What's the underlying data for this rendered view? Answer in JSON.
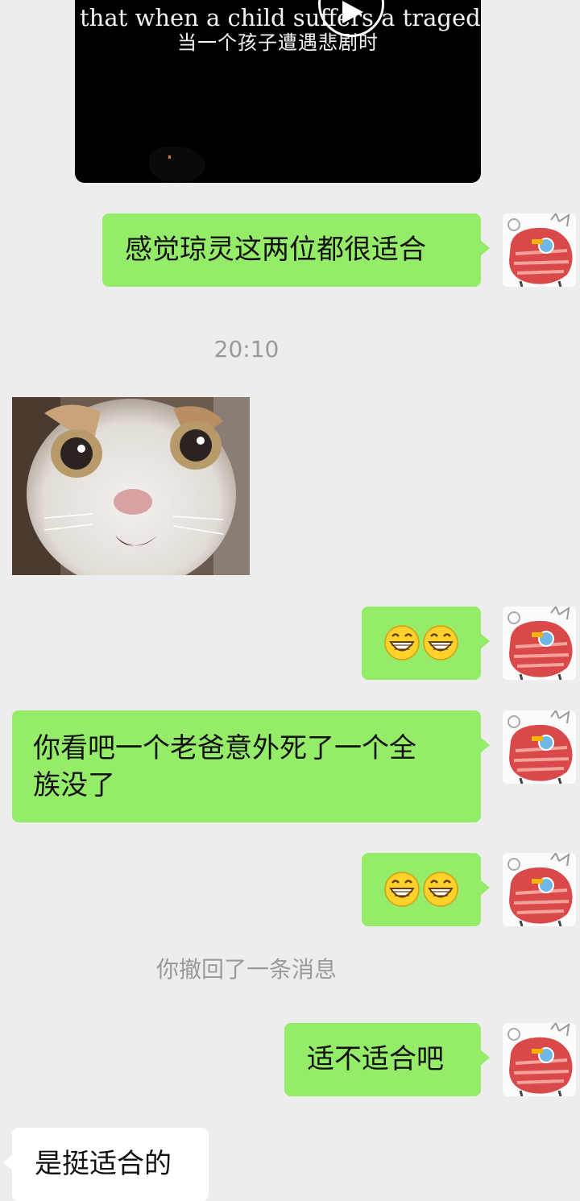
{
  "video": {
    "subtitle_en": "that when a child suffers a traged",
    "subtitle_zh": "当一个孩子遭遇悲剧时",
    "play_icon": "play-icon"
  },
  "messages": [
    {
      "id": "m1",
      "side": "sent",
      "text": "感觉琼灵这两位都很适合"
    },
    {
      "id": "ts",
      "type": "timestamp",
      "text": "20:10"
    },
    {
      "id": "m2",
      "side": "recv",
      "type": "image",
      "description_icon": "cat-meme-image"
    },
    {
      "id": "m3",
      "side": "sent",
      "type": "emoji",
      "emojis": [
        "grinning-face-emoji",
        "grinning-face-emoji"
      ]
    },
    {
      "id": "m4",
      "side": "sent",
      "text": "你看吧一个老爸意外死了一个全族没了"
    },
    {
      "id": "m5",
      "side": "sent",
      "type": "emoji",
      "emojis": [
        "grinning-face-emoji",
        "grinning-face-emoji"
      ]
    },
    {
      "id": "rv",
      "type": "system",
      "text": "你撤回了一条消息"
    },
    {
      "id": "m6",
      "side": "sent",
      "text": "适不适合吧"
    },
    {
      "id": "m7",
      "side": "recv",
      "text": "是挺适合的"
    }
  ],
  "m4_lines": [
    "你看吧一个老爸意外死了一个全",
    "族没了"
  ],
  "colors": {
    "background": "#ededed",
    "sent_bubble": "#95ec69",
    "recv_bubble": "#ffffff",
    "system_text": "#9a9a9a"
  }
}
